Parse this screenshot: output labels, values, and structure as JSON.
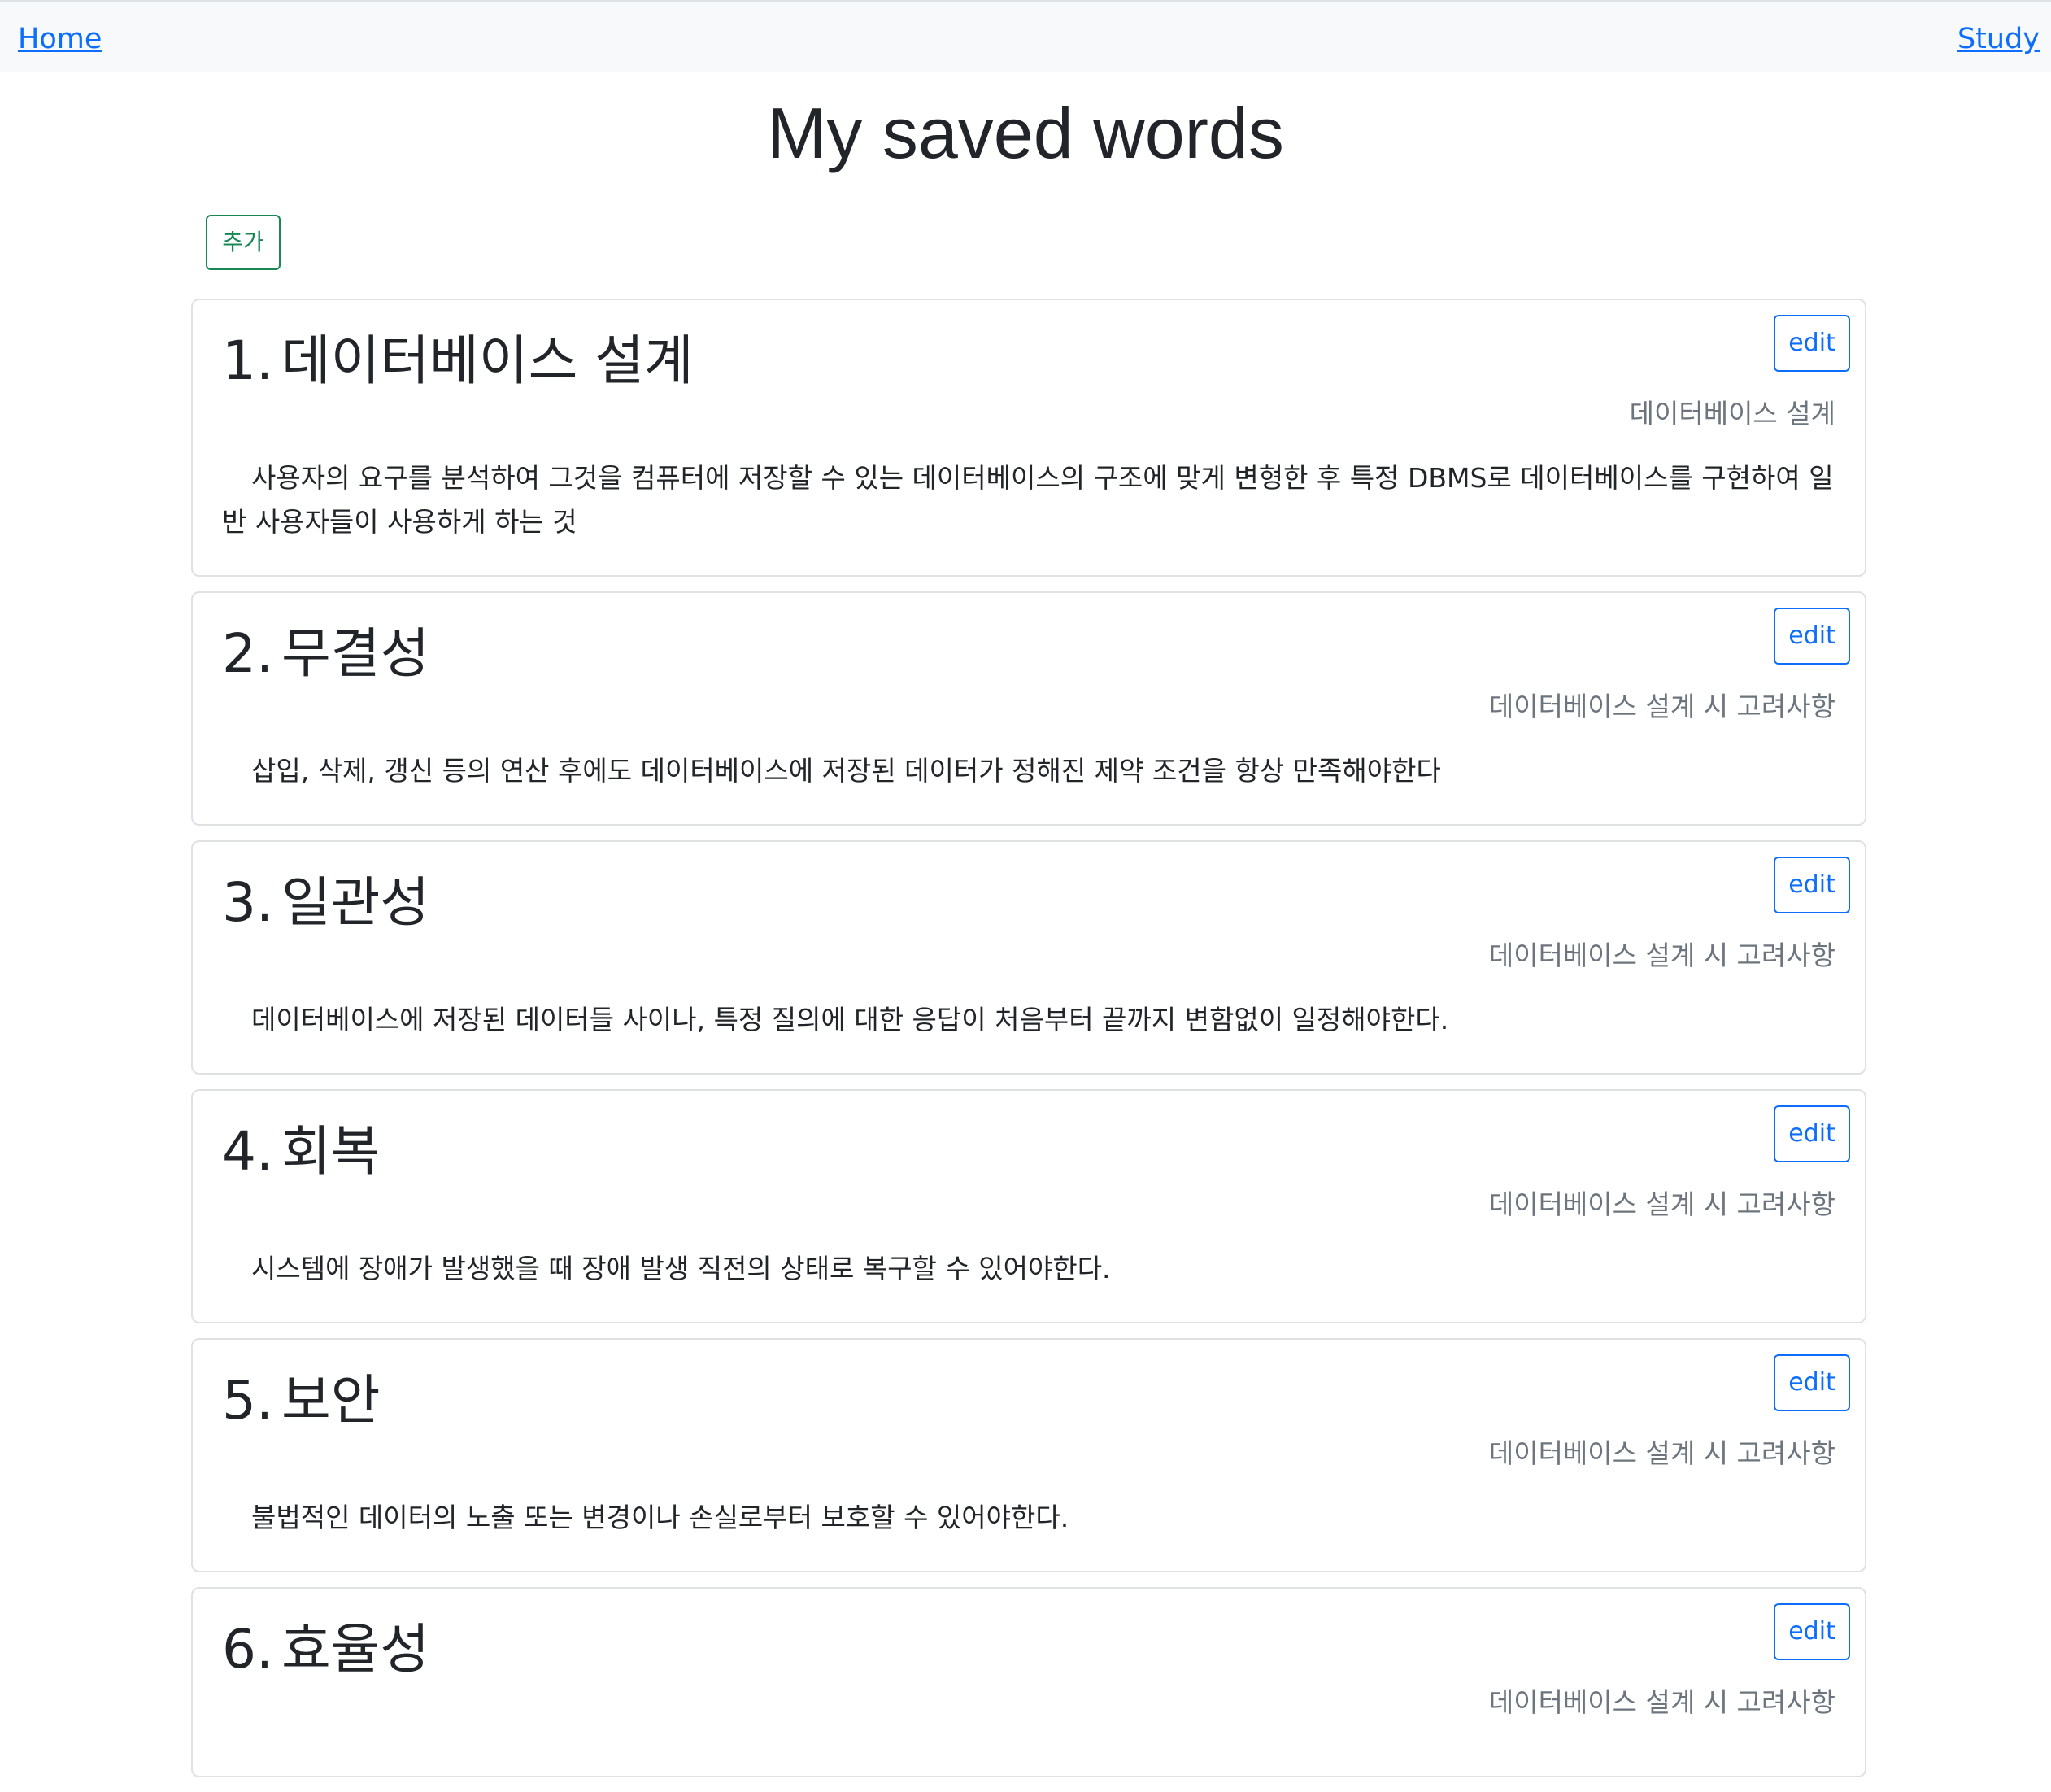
{
  "nav": {
    "home_label": "Home",
    "study_label": "Study"
  },
  "page": {
    "title": "My saved words",
    "add_label": "추가"
  },
  "cards": [
    {
      "number": "1.",
      "term": "데이터베이스 설계",
      "category": "데이터베이스 설계",
      "definition": "사용자의 요구를 분석하여 그것을 컴퓨터에 저장할 수 있는 데이터베이스의 구조에 맞게 변형한 후 특정 DBMS로 데이터베이스를 구현하여 일반 사용자들이 사용하게 하는 것",
      "edit_label": "edit"
    },
    {
      "number": "2.",
      "term": "무결성",
      "category": "데이터베이스 설계 시 고려사항",
      "definition": "삽입, 삭제, 갱신 등의 연산 후에도 데이터베이스에 저장된 데이터가 정해진 제약 조건을 항상 만족해야한다",
      "edit_label": "edit"
    },
    {
      "number": "3.",
      "term": "일관성",
      "category": "데이터베이스 설계 시 고려사항",
      "definition": "데이터베이스에 저장된 데이터들 사이나, 특정 질의에 대한 응답이 처음부터 끝까지 변함없이 일정해야한다.",
      "edit_label": "edit"
    },
    {
      "number": "4.",
      "term": "회복",
      "category": "데이터베이스 설계 시 고려사항",
      "definition": "시스템에 장애가 발생했을 때 장애 발생 직전의 상태로 복구할 수 있어야한다.",
      "edit_label": "edit"
    },
    {
      "number": "5.",
      "term": "보안",
      "category": "데이터베이스 설계 시 고려사항",
      "definition": "불법적인 데이터의 노출 또는 변경이나 손실로부터 보호할 수 있어야한다.",
      "edit_label": "edit"
    },
    {
      "number": "6.",
      "term": "효율성",
      "category": "데이터베이스 설계 시 고려사항",
      "definition": "",
      "edit_label": "edit"
    }
  ]
}
